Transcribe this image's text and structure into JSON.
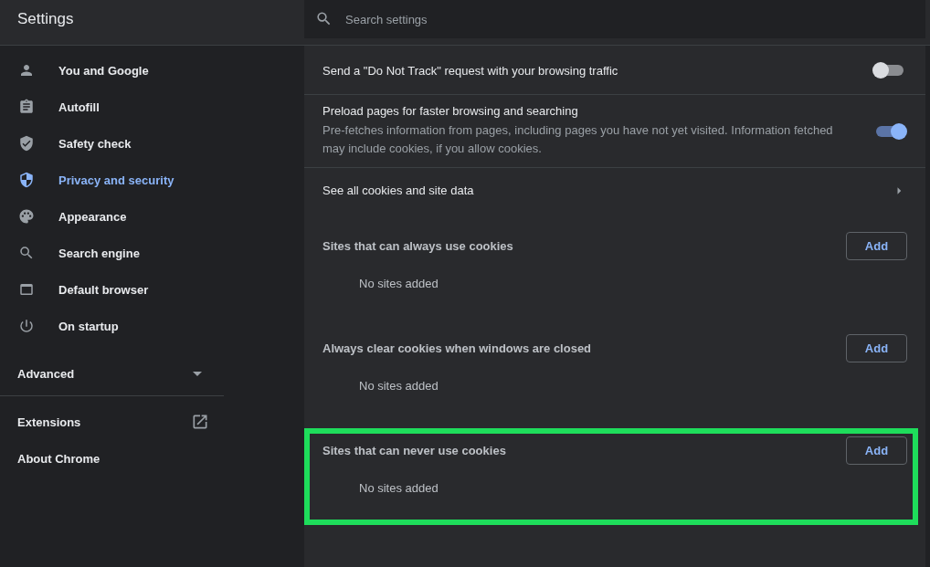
{
  "header": {
    "title": "Settings"
  },
  "search": {
    "placeholder": "Search settings"
  },
  "sidebar": {
    "items": [
      {
        "label": "You and Google",
        "selected": false
      },
      {
        "label": "Autofill",
        "selected": false
      },
      {
        "label": "Safety check",
        "selected": false
      },
      {
        "label": "Privacy and security",
        "selected": true
      },
      {
        "label": "Appearance",
        "selected": false
      },
      {
        "label": "Search engine",
        "selected": false
      },
      {
        "label": "Default browser",
        "selected": false
      },
      {
        "label": "On startup",
        "selected": false
      }
    ],
    "advanced": {
      "label": "Advanced",
      "expanded": false
    },
    "links": [
      {
        "label": "Extensions",
        "kind": "external"
      },
      {
        "label": "About Chrome",
        "kind": "plain"
      }
    ]
  },
  "settings": [
    {
      "kind": "toggle",
      "label": "Send a \"Do Not Track\" request with your browsing traffic",
      "on": false
    },
    {
      "kind": "toggle",
      "label": "Preload pages for faster browsing and searching",
      "description": "Pre-fetches information from pages, including pages you have not yet visited. Information fetched may include cookies, if you allow cookies.",
      "on": true
    },
    {
      "kind": "link",
      "label": "See all cookies and site data"
    }
  ],
  "cookie_sections": [
    {
      "title": "Sites that can always use cookies",
      "button": "Add",
      "empty_text": "No sites added",
      "highlighted": false
    },
    {
      "title": "Always clear cookies when windows are closed",
      "button": "Add",
      "empty_text": "No sites added",
      "highlighted": false
    },
    {
      "title": "Sites that can never use cookies",
      "button": "Add",
      "empty_text": "No sites added",
      "highlighted": true
    }
  ]
}
